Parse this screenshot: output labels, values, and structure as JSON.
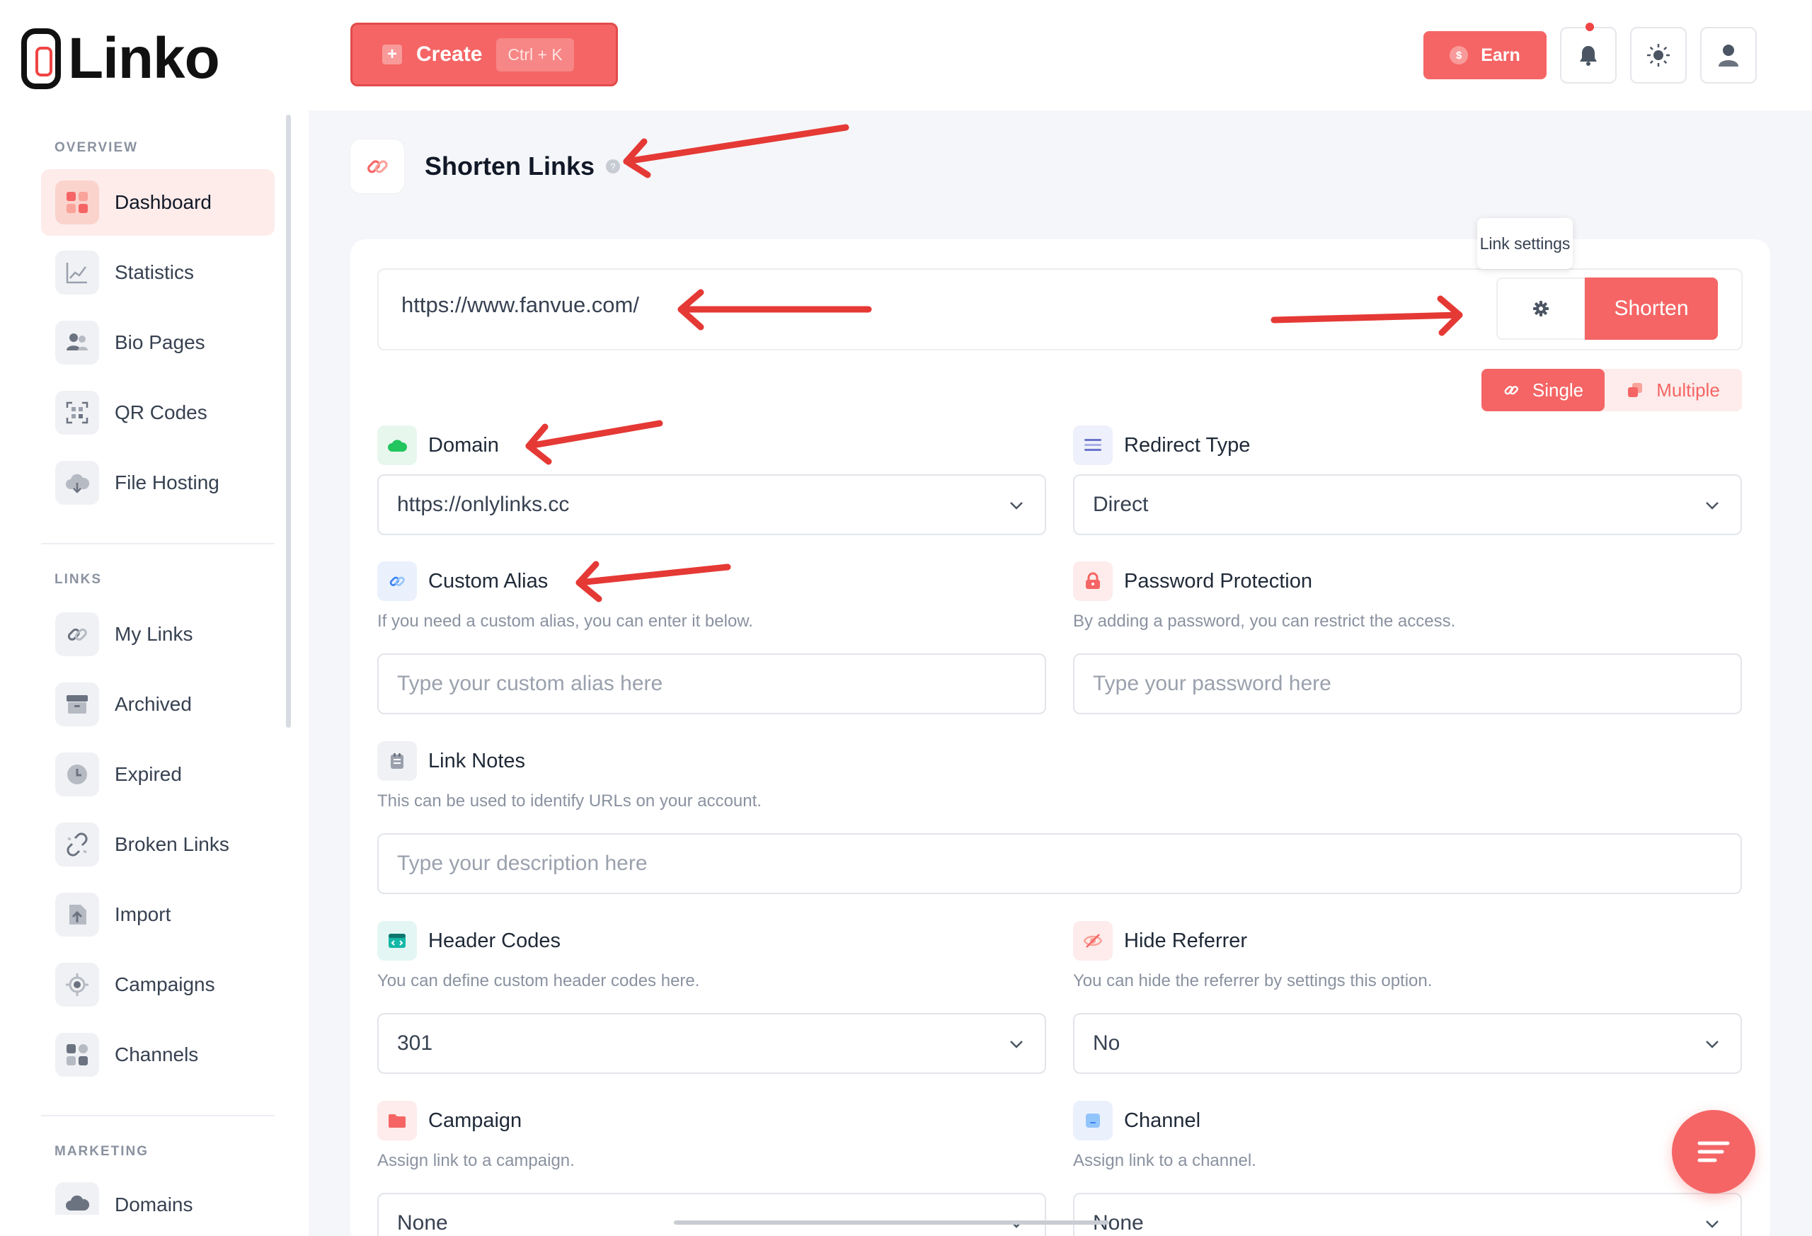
{
  "brand": {
    "name": "Linko"
  },
  "sidebar": {
    "sections": [
      {
        "title": "OVERVIEW",
        "items": [
          {
            "label": "Dashboard",
            "icon": "dashboard-icon",
            "active": true
          },
          {
            "label": "Statistics",
            "icon": "chart-icon"
          },
          {
            "label": "Bio Pages",
            "icon": "users-icon"
          },
          {
            "label": "QR Codes",
            "icon": "qr-icon"
          },
          {
            "label": "File Hosting",
            "icon": "cloud-icon"
          }
        ]
      },
      {
        "title": "LINKS",
        "items": [
          {
            "label": "My Links",
            "icon": "link-icon"
          },
          {
            "label": "Archived",
            "icon": "archive-icon"
          },
          {
            "label": "Expired",
            "icon": "clock-icon"
          },
          {
            "label": "Broken Links",
            "icon": "broken-link-icon"
          },
          {
            "label": "Import",
            "icon": "import-icon"
          },
          {
            "label": "Campaigns",
            "icon": "target-icon"
          },
          {
            "label": "Channels",
            "icon": "grid-icon"
          }
        ]
      },
      {
        "title": "MARKETING",
        "items": [
          {
            "label": "Domains",
            "icon": "cloud-icon"
          }
        ]
      }
    ]
  },
  "topbar": {
    "create_label": "Create",
    "create_shortcut": "Ctrl + K",
    "earn_label": "Earn"
  },
  "page": {
    "title": "Shorten Links",
    "help": "?"
  },
  "shorten": {
    "url_value": "https://www.fanvue.com/",
    "tooltip": "Link settings",
    "button_label": "Shorten",
    "mode_single": "Single",
    "mode_multiple": "Multiple"
  },
  "form": {
    "domain": {
      "label": "Domain",
      "value": "https://onlylinks.cc"
    },
    "redirect": {
      "label": "Redirect Type",
      "value": "Direct"
    },
    "alias": {
      "label": "Custom Alias",
      "helper": "If you need a custom alias, you can enter it below.",
      "placeholder": "Type your custom alias here"
    },
    "password": {
      "label": "Password Protection",
      "helper": "By adding a password, you can restrict the access.",
      "placeholder": "Type your password here"
    },
    "notes": {
      "label": "Link Notes",
      "helper": "This can be used to identify URLs on your account.",
      "placeholder": "Type your description here"
    },
    "header_codes": {
      "label": "Header Codes",
      "helper": "You can define custom header codes here.",
      "value": "301"
    },
    "hide_referrer": {
      "label": "Hide Referrer",
      "helper": "You can hide the referrer by settings this option.",
      "value": "No"
    },
    "campaign": {
      "label": "Campaign",
      "helper": "Assign link to a campaign.",
      "value": "None"
    },
    "channel": {
      "label": "Channel",
      "helper": "Assign link to a channel.",
      "value": "None"
    }
  },
  "colors": {
    "accent": "#f56565",
    "annotation_arrow": "#e53935"
  }
}
